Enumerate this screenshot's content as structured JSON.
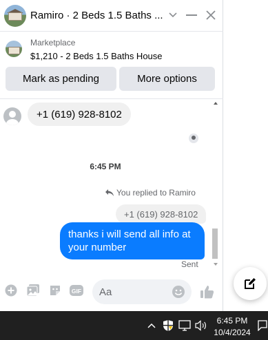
{
  "header": {
    "title": "Ramiro · 2 Beds 1.5 Baths ...",
    "chevron_icon": "chevron-down-icon",
    "minimize_icon": "minimize-icon",
    "close_icon": "close-icon"
  },
  "listing": {
    "source": "Marketplace",
    "summary": "$1,210 - 2 Beds 1.5 Baths House"
  },
  "actions": {
    "mark_pending": "Mark as pending",
    "more_options": "More options"
  },
  "thread": {
    "incoming_message": "+1 (619) 928-8102",
    "timestamp": "6:45 PM",
    "replied_label": "You replied to Ramiro",
    "quoted_message": "+1 (619) 928-8102",
    "outgoing_message": "thanks i will send all info at your number",
    "status": "Sent"
  },
  "composer": {
    "placeholder": "Aa",
    "icons": [
      "add-circle-icon",
      "photo-icon",
      "sticker-icon",
      "gif-icon",
      "emoji-icon",
      "thumbs-up-icon"
    ],
    "gif_label": "GIF"
  },
  "fab": {
    "icon": "compose-icon"
  },
  "taskbar": {
    "time": "6:45 PM",
    "date": "10/4/2024",
    "icons": [
      "chevron-up-icon",
      "security-shield-icon",
      "network-icon",
      "volume-icon",
      "notification-icon"
    ]
  },
  "colors": {
    "accent": "#0a7cff",
    "bubble_gray": "#f0f0f0",
    "button_gray": "#e4e6eb",
    "taskbar": "#202020"
  }
}
